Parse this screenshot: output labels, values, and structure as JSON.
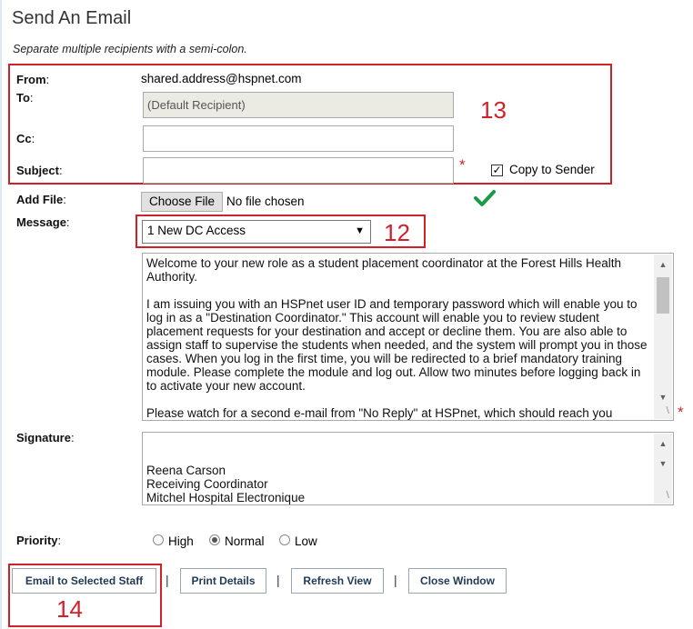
{
  "dialog": {
    "title": "Send An Email",
    "hint": "Separate multiple recipients with a semi-colon."
  },
  "form": {
    "from_label": "From",
    "from_value": "shared.address@hspnet.com",
    "to_label": "To",
    "to_value": "(Default Recipient)",
    "cc_label": "Cc",
    "cc_value": "",
    "subject_label": "Subject",
    "subject_value": "",
    "copy_to_sender_label": "Copy to Sender",
    "copy_to_sender_checked": true,
    "add_file_label": "Add File",
    "choose_file_button": "Choose File",
    "no_file_text": "No file chosen",
    "message_label": "Message",
    "message_template": "1 New DC Access",
    "message_body": "Welcome to your new role as a student placement coordinator at the Forest Hills Health Authority.\n\nI am issuing you with an HSPnet user ID and temporary password which will enable you to log in as a \"Destination Coordinator.\" This account will enable you to review student placement requests for your destination and accept or decline them. You are also able to assign staff to supervise the students when needed, and the system will prompt you in those cases. When you log in the first time, you will be redirected to a brief mandatory training module. Please complete the module and log out. Allow two minutes before logging back in to activate your new account.\n\nPlease watch for a second e-mail from \"No Reply\" at HSPnet, which should reach you",
    "signature_label": "Signature",
    "signature_body": "\nReena Carson\nReceiving Coordinator\nMitchel Hospital Electronique",
    "priority_label": "Priority",
    "priority_options": [
      "High",
      "Normal",
      "Low"
    ],
    "priority_selected": "Normal"
  },
  "actions": {
    "email_button": "Email to Selected Staff",
    "print_button": "Print Details",
    "refresh_button": "Refresh View",
    "close_button": "Close Window",
    "separator": "|"
  },
  "annotations": {
    "box_13": "13",
    "box_12": "12",
    "box_14": "14"
  },
  "colors": {
    "annotation_red": "#d0202a",
    "checkmark_green": "#1a9a4b",
    "button_text": "#1e3a56"
  },
  "icons": [
    "checkbox-checked-icon",
    "green-checkmark-icon",
    "dropdown-arrow-icon",
    "scroll-up-icon",
    "scroll-down-icon",
    "resize-grip-icon",
    "radio-icon"
  ]
}
